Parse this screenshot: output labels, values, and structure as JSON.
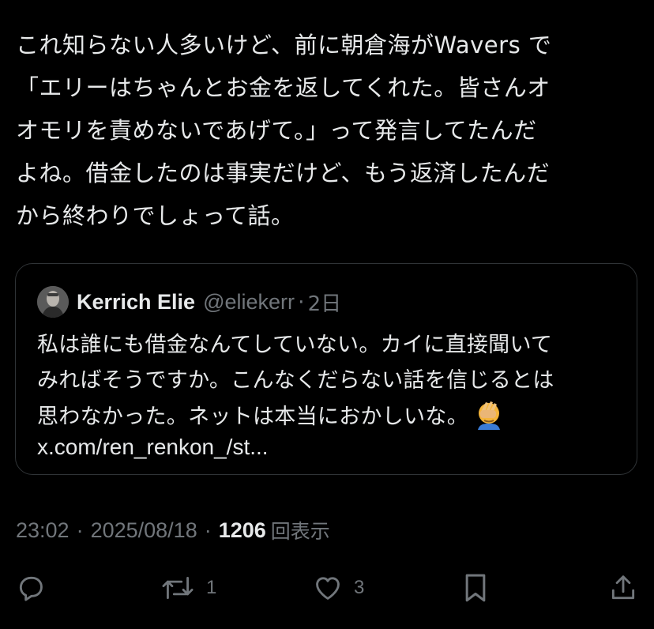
{
  "post": {
    "text": "これ知らない人多いけど、前に朝倉海がWavers で\n「エリーはちゃんとお金を返してくれた。皆さんオ\nオモリを責めないであげて。」って発言してたんだ\nよね。借金したのは事実だけど、もう返済したんだ\nから終わりでしょって話。"
  },
  "quote": {
    "avatar_icon": "person-avatar",
    "display_name": "Kerrich Elie",
    "handle": "@eliekerr",
    "separator": "·",
    "time": "2日",
    "text": "私は誰にも借金なんてしていない。カイに直接聞いて\nみればそうですか。こんなくだらない話を信じるとは\n思わなかった。ネットは本当におかしいな。",
    "emoji_icon": "face-palm-emoji",
    "link": "x.com/ren_renkon_/st..."
  },
  "meta": {
    "time": "23:02",
    "separator": "·",
    "date": "2025/08/18",
    "views_count": "1206",
    "views_label": "回表示"
  },
  "actions": {
    "reply_icon": "reply-icon",
    "repost_icon": "repost-icon",
    "repost_count": "1",
    "like_icon": "heart-icon",
    "like_count": "3",
    "bookmark_icon": "bookmark-icon",
    "share_icon": "share-icon"
  },
  "colors": {
    "background": "#000000",
    "text_primary": "#e7e9ea",
    "text_secondary": "#71767b",
    "border": "#2f3336"
  }
}
